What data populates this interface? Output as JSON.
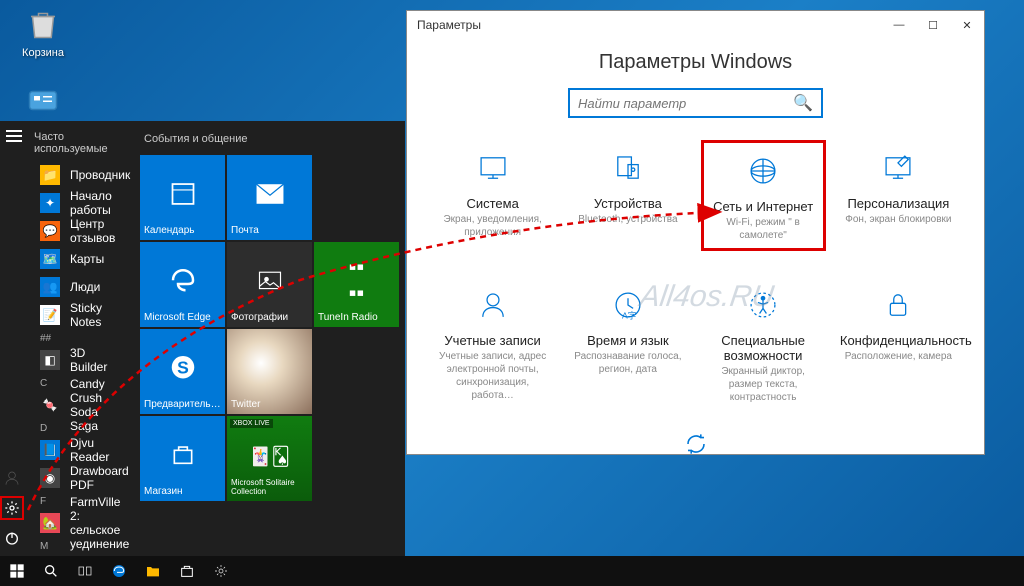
{
  "desktop": {
    "trash": "Корзина",
    "control_panel": "Панель управления"
  },
  "startmenu": {
    "frequently_used": "Часто используемые",
    "apps": [
      "Проводник",
      "Начало работы",
      "Центр отзывов",
      "Карты",
      "Люди",
      "Sticky Notes"
    ],
    "letter_dots": "##",
    "letters": [
      "3D Builder",
      "C",
      "Candy Crush Soda Saga",
      "D",
      "Djvu Reader",
      "Drawboard PDF",
      "F",
      "FarmVille 2: сельское уединение",
      "M"
    ],
    "tiles_header": "События и общение",
    "tiles": {
      "calendar": "Календарь",
      "mail": "Почта",
      "edge": "Microsoft Edge",
      "photos": "Фотографии",
      "tunein": "TuneIn Radio",
      "skype": "Предваритель…",
      "twitter": "Twitter",
      "store": "Магазин",
      "solitaire": "Microsoft Solitaire Collection",
      "xbox_badge": "XBOX LIVE"
    }
  },
  "settings": {
    "window_title": "Параметры",
    "heading": "Параметры Windows",
    "search_placeholder": "Найти параметр",
    "categories_top": [
      {
        "title": "Система",
        "desc": "Экран, уведомления, приложения"
      },
      {
        "title": "Устройства",
        "desc": "Bluetooth, устройства"
      },
      {
        "title": "Сеть и Интернет",
        "desc": "Wi-Fi, режим \" в самолете\""
      },
      {
        "title": "Персонализация",
        "desc": "Фон, экран блокировки"
      }
    ],
    "categories_bottom": [
      {
        "title": "Учетные записи",
        "desc": "Учетные записи, адрес электронной почты, синхронизация, работа…"
      },
      {
        "title": "Время и язык",
        "desc": "Распознавание голоса, регион, дата"
      },
      {
        "title": "Специальные возможности",
        "desc": "Экранный диктор, размер текста, контрастность"
      },
      {
        "title": "Конфиденциальность",
        "desc": "Расположение, камера"
      }
    ]
  }
}
